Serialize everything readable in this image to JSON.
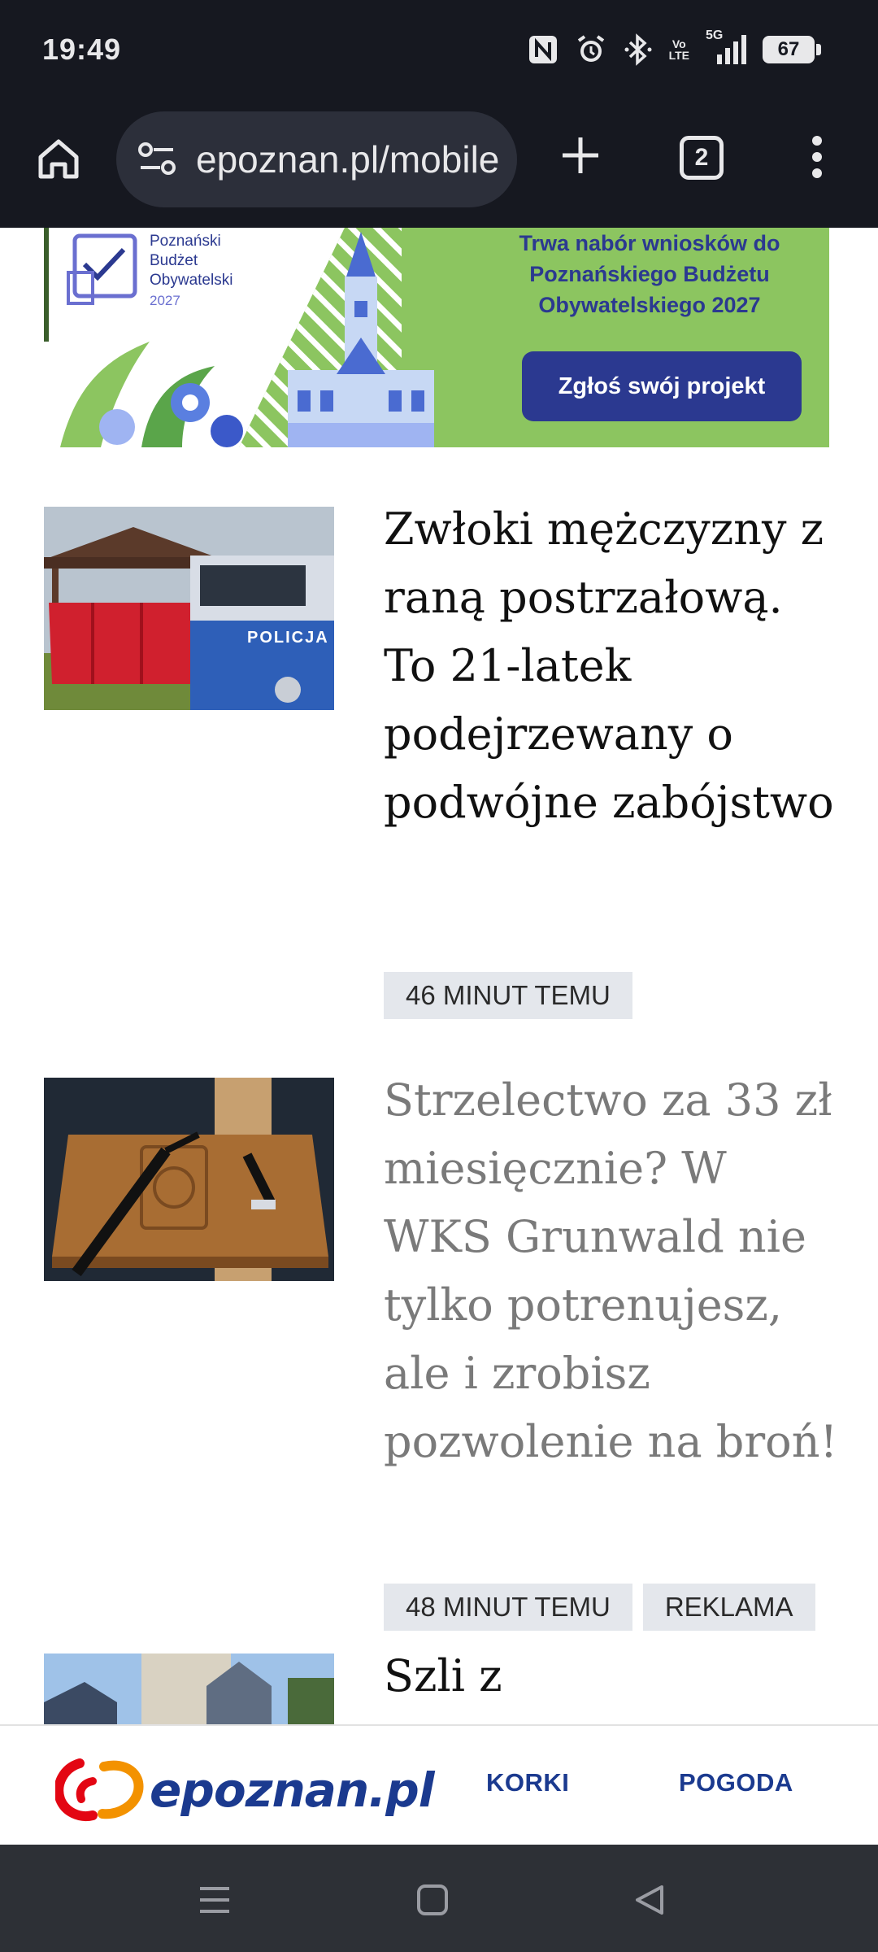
{
  "status_bar": {
    "time": "19:49",
    "icons": [
      "nfc-icon",
      "alarm-icon",
      "bluetooth-icon",
      "volte-icon",
      "signal-5g-icon",
      "battery-icon"
    ],
    "volte_label_top": "Vo",
    "volte_label_bottom": "LTE",
    "network_label": "5G",
    "battery_level": "67"
  },
  "browser": {
    "url": "epoznan.pl/mobile",
    "tab_count": "2",
    "icons": [
      "home-icon",
      "site-settings-icon",
      "new-tab-icon",
      "tabs-icon",
      "more-menu-icon"
    ]
  },
  "banner": {
    "logo_line1": "Poznański",
    "logo_line2": "Budżet",
    "logo_line3": "Obywatelski",
    "logo_year": "2027",
    "headline_line1": "Trwa nabór wniosków do",
    "headline_line2": "Poznańskiego Budżetu",
    "headline_line3": "Obywatelskiego 2027",
    "cta_label": "Zgłoś swój projekt",
    "colors": {
      "background": "#8cc560",
      "accent": "#2b3990"
    }
  },
  "articles": [
    {
      "title": "Zwłoki mężczyzny z raną postrzałową. To 21-latek podejrzewany o podwójne zabójstwo",
      "time": "46 MINUT TEMU",
      "thumbnail_car_text": "POLICJA"
    },
    {
      "title": "Strzelectwo za 33 zł miesięcznie? W WKS Grunwald nie tylko potrenujesz, ale i zrobisz pozwolenie na broń!",
      "time": "48 MINUT TEMU",
      "label": "REKLAMA"
    },
    {
      "title": "Szli z"
    }
  ],
  "bottom_bar": {
    "logo": "epoznan.pl",
    "links": [
      "KORKI",
      "POGODA"
    ]
  },
  "android_nav": {
    "icons": [
      "recents-menu-icon",
      "home-square-icon",
      "back-triangle-icon"
    ]
  },
  "colors": {
    "system_bar": "#161820",
    "brand_blue": "#1b3a8f",
    "brand_orange": "#f39200",
    "brand_red": "#e30613",
    "tag_background": "#e4e7ec"
  }
}
